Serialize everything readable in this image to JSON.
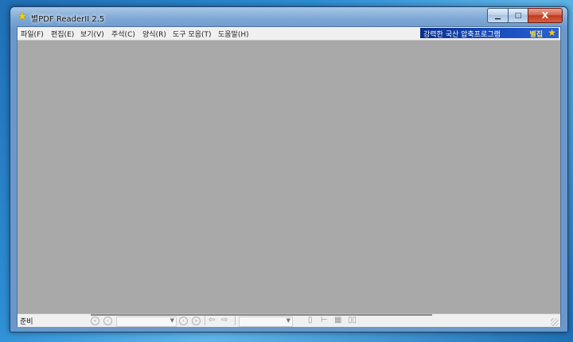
{
  "window": {
    "title": "별PDF ReaderII 2.5",
    "controls": {
      "minimize": "▁",
      "maximize": "□",
      "close": "X"
    }
  },
  "menu": [
    {
      "label": "파일(F)"
    },
    {
      "label": "편집(E)"
    },
    {
      "label": "보기(V)"
    },
    {
      "label": "주석(C)"
    },
    {
      "label": "양식(R)"
    },
    {
      "label": "도구 모음(T)"
    },
    {
      "label": "도움말(H)"
    }
  ],
  "promo": {
    "text": "강력한 국산 압축프로그램",
    "brand": "별집",
    "icon": "star-icon"
  },
  "statusbar": {
    "status": "준비",
    "page_input": "",
    "zoom_value": ""
  },
  "colors": {
    "workspace": "#a9a9a9",
    "promo_bg": "#1a4fc0",
    "promo_brand": "#ffe34d"
  }
}
